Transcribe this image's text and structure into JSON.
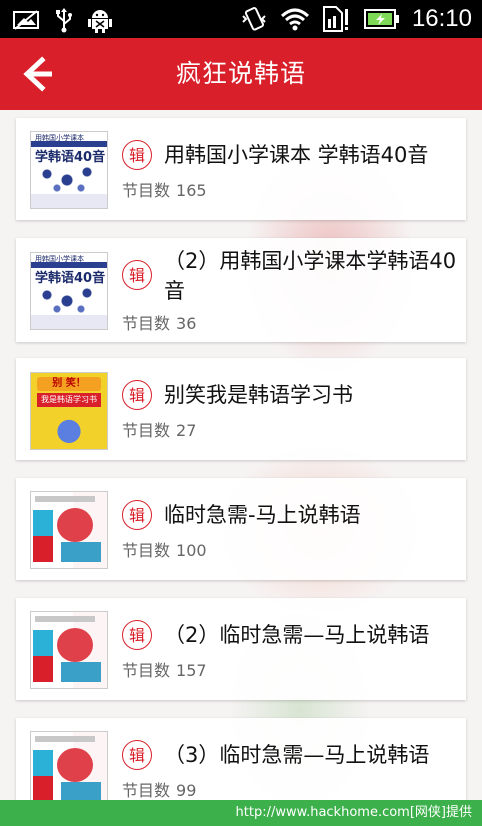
{
  "status_bar": {
    "time": "16:10",
    "left_icons": [
      "gallery-icon",
      "usb-icon",
      "android-debug-icon"
    ],
    "right_icons": [
      "vibrate-icon",
      "wifi-icon",
      "sim-signal-icon",
      "battery-charging-icon"
    ]
  },
  "app_bar": {
    "back_icon": "arrow-left-icon",
    "title": "疯狂说韩语",
    "color": "#d9202a"
  },
  "list": {
    "items": [
      {
        "badge": "辑",
        "title": "用韩国小学课本 学韩语40音",
        "meta_label": "节目数",
        "count": "165",
        "cover": "blue",
        "cover_text": {
          "top": "用韩国小学课本",
          "main": "学韩语40音"
        }
      },
      {
        "badge": "辑",
        "title": "（2）用韩国小学课本学韩语40音",
        "meta_label": "节目数",
        "count": "36",
        "cover": "blue",
        "cover_text": {
          "top": "用韩国小学课本",
          "main": "学韩语40音"
        }
      },
      {
        "badge": "辑",
        "title": "别笑我是韩语学习书",
        "meta_label": "节目数",
        "count": "27",
        "cover": "yellow",
        "cover_text": {
          "top": "别 笑！",
          "main": "我是韩语学习书"
        }
      },
      {
        "badge": "辑",
        "title": "临时急需-马上说韩语",
        "meta_label": "节目数",
        "count": "100",
        "cover": "white"
      },
      {
        "badge": "辑",
        "title": "（2）临时急需—马上说韩语",
        "meta_label": "节目数",
        "count": "157",
        "cover": "white"
      },
      {
        "badge": "辑",
        "title": "（3）临时急需—马上说韩语",
        "meta_label": "节目数",
        "count": "99",
        "cover": "white"
      }
    ]
  },
  "footer": {
    "watermark": "http://www.hackhome.com[网侠]提供",
    "color": "#3cb04a"
  }
}
